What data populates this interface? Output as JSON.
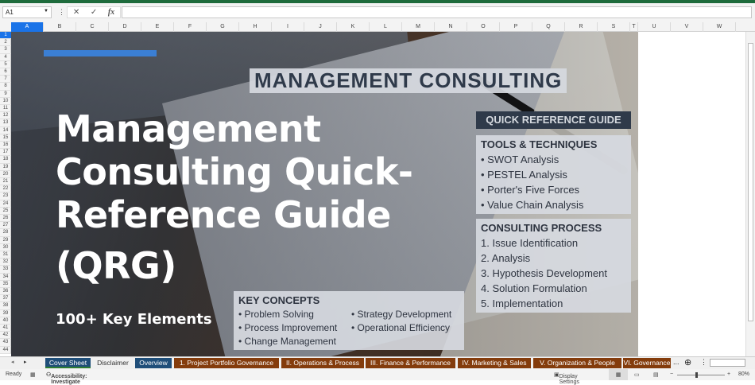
{
  "namebox": {
    "value": "A1"
  },
  "formula_bar": {
    "cancel": "✕",
    "enter": "✓",
    "fx": "fx"
  },
  "columns": [
    "A",
    "B",
    "C",
    "D",
    "E",
    "F",
    "G",
    "H",
    "I",
    "J",
    "K",
    "L",
    "M",
    "N",
    "O",
    "P",
    "Q",
    "R",
    "S",
    "T",
    "U",
    "V",
    "W"
  ],
  "rows": [
    "1",
    "2",
    "3",
    "4",
    "5",
    "6",
    "7",
    "8",
    "9",
    "10",
    "11",
    "12",
    "13",
    "14",
    "15",
    "16",
    "17",
    "18",
    "19",
    "20",
    "21",
    "22",
    "23",
    "24",
    "25",
    "26",
    "27",
    "28",
    "29",
    "30",
    "31",
    "32",
    "33",
    "34",
    "35",
    "36",
    "37",
    "38",
    "39",
    "40",
    "41",
    "42",
    "43",
    "44"
  ],
  "hero": {
    "title_lines": [
      "Management",
      "Consulting Quick-",
      "Reference Guide",
      "(QRG)"
    ],
    "subtitle": "100+ Key Elements",
    "photo": {
      "heading": "MANAGEMENT CONSULTING",
      "band": "QUICK REFERENCE GUIDE",
      "key_concepts": {
        "title": "KEY CONCEPTS",
        "items": [
          "Problem Solving",
          "Strategy Development",
          "Process Improvement",
          "Operational Efficiency",
          "Change Management"
        ]
      },
      "process": {
        "title": "CONSULTING PROCESS",
        "items": [
          "1. Issue Identification",
          "2. Analysis",
          "3. Hypothesis Development",
          "4. Solution Formulation",
          "5. Implementation"
        ]
      },
      "tools": {
        "title": "TOOLS & TECHNIQUES",
        "items": [
          "SWOT Analysis",
          "PESTEL Analysis",
          "Porter's Five Forces",
          "Value Chain Analysis"
        ]
      }
    }
  },
  "sheet_tabs": [
    {
      "label": "Cover Sheet",
      "style": "blue",
      "active": true
    },
    {
      "label": "Disclaimer",
      "style": "plain"
    },
    {
      "label": "Overview",
      "style": "blue"
    },
    {
      "label": "1. Project Portfolio Governance",
      "style": "brown"
    },
    {
      "label": "II. Operations & Process",
      "style": "brown"
    },
    {
      "label": "III. Finance & Performance",
      "style": "brown"
    },
    {
      "label": "IV. Marketing & Sales",
      "style": "brown"
    },
    {
      "label": "V. Organization & People",
      "style": "brown"
    },
    {
      "label": "VI. Governance",
      "style": "brown"
    }
  ],
  "tabs_more": "...",
  "status": {
    "ready": "Ready",
    "accessibility": "Accessibility: Investigate",
    "display_settings": "Display Settings",
    "zoom": "80%"
  },
  "colors": {
    "accent": "#3b7fd4",
    "tab_blue": "#1f4e79",
    "tab_brown": "#843c0c",
    "excel_green": "#1e6b3c"
  }
}
